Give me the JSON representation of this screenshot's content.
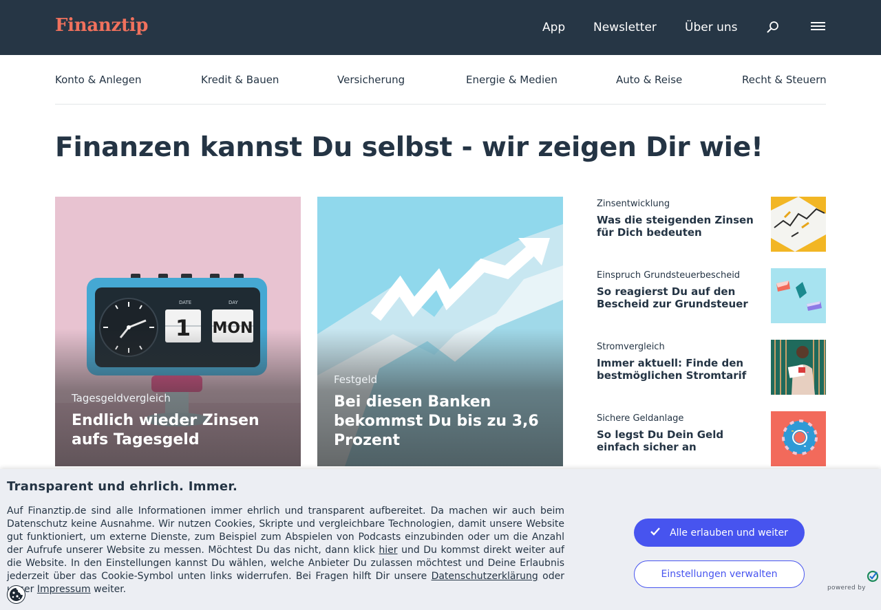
{
  "brand": {
    "logo_text": "Finanztip",
    "logo_color": "#f0715d",
    "header_bg": "#263645",
    "accent": "#4754ef"
  },
  "topnav": {
    "app": "App",
    "newsletter": "Newsletter",
    "about": "Über uns",
    "search_icon": "search-icon",
    "menu_icon": "hamburger-menu-icon"
  },
  "categories": [
    "Konto & Anlegen",
    "Kredit & Bauen",
    "Versicherung",
    "Energie & Medien",
    "Auto & Reise",
    "Recht & Steuern"
  ],
  "headline": "Finanzen kannst Du selbst - wir zeigen Dir wie!",
  "featured": [
    {
      "kicker": "Tagesgeldvergleich",
      "title": "Endlich wieder Zinsen aufs Tagesgeld",
      "image": "alarm-clock-image",
      "clock_date": "1",
      "clock_day": "MON",
      "date_label": "DATE",
      "day_label": "DAY"
    },
    {
      "kicker": "Festgeld",
      "title": "Bei diesen Banken bekommst Du bis zu 3,6 Prozent",
      "image": "paper-chart-arrow-image"
    }
  ],
  "sidebar": [
    {
      "kicker": "Zinsentwicklung",
      "title": "Was die steigenden Zinsen für Dich bedeuten",
      "image": "chart-paper-image"
    },
    {
      "kicker": "Einspruch Grundsteuerbescheid",
      "title": "So reagierst Du auf den Bescheid zur Grundsteuer",
      "image": "paper-shapes-image"
    },
    {
      "kicker": "Stromvergleich",
      "title": "Immer aktuell: Finde den bestmöglichen Stromtarif",
      "image": "woman-reading-image"
    },
    {
      "kicker": "Sichere Geldanlage",
      "title": "So legst Du Dein Geld einfach sicher an",
      "image": "donut-image"
    }
  ],
  "cookie": {
    "title": "Transparent und ehrlich. Immer.",
    "text_1": "Auf Finanztip.de sind alle Informationen immer ehrlich und transparent aufbereitet. Da machen wir auch beim Datenschutz keine Ausnahme. Wir nutzen Cookies, Skripte und vergleichbare Technologien, damit unsere Website gut funktioniert, um externe Dienste, zum Beispiel zum Abspielen von Podcasts einzubinden oder um die Anzahl der Aufrufe unserer Website zu messen. Möchtest Du das nicht, dann klick ",
    "link_here": "hier",
    "text_2": " und Du kommst direkt weiter auf die Website. In den Einstellungen kannst Du wählen, welche Anbieter Du zulassen möchtest und Deine Erlaubnis jederzeit über das Cookie-Symbol unten links widerrufen. Bei Fragen hilft Dir unsere ",
    "link_privacy": "Datenschutzerklärung",
    "text_3": " oder unser ",
    "link_imprint": "Impressum",
    "text_4": " weiter.",
    "accept_label": "Alle erlauben und weiter",
    "settings_label": "Einstellungen verwalten",
    "powered_by": "powered by"
  }
}
